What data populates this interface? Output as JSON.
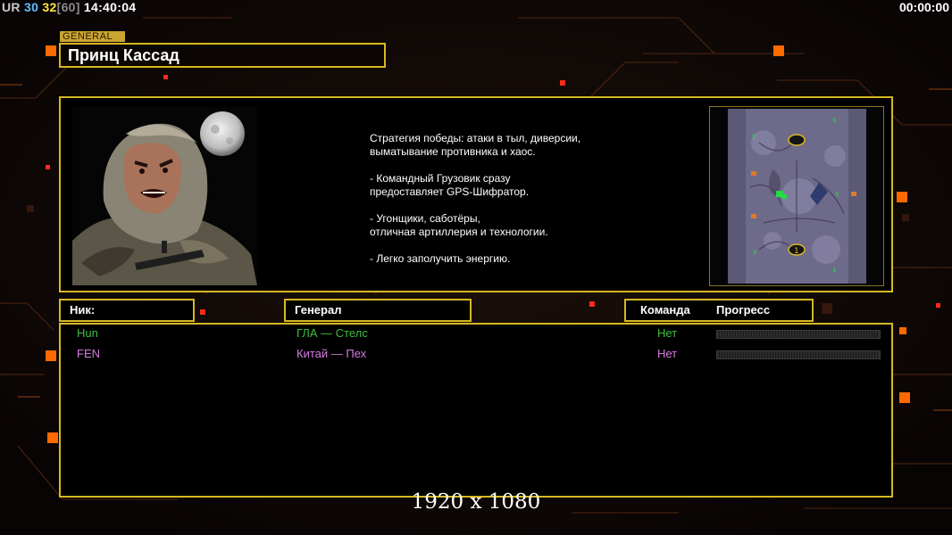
{
  "hud": {
    "ur": "UR",
    "fps_a": "30",
    "fps_b": "32",
    "fps_cap": "[60]",
    "clock": "14:40:04",
    "timer": "00:00:00"
  },
  "general": {
    "tag": "GENERAL",
    "name": "Принц Кассад",
    "description": "Стратегия победы: атаки в тыл, диверсии,\n выматывание противника и хаос.\n\n- Командный Грузовик сразу\nпредоставляет GPS-Шифратор.\n\n- Угонщики, саботёры,\nотличная артиллерия и технологии.\n\n- Легко заполучить энергию.",
    "portrait_icon": "gla-soldier-portrait",
    "map_icon": "minimap-preview"
  },
  "columns": {
    "nick": "Ник:",
    "general": "Генерал",
    "team": "Команда",
    "progress": "Прогресс"
  },
  "players": [
    {
      "nick": "Hun",
      "general": "ГЛА — Стелс",
      "team": "Нет",
      "progress": 0,
      "color": "#3fbf3f"
    },
    {
      "nick": "FEN",
      "general": "Китай — Пех",
      "team": "Нет",
      "progress": 0,
      "color": "#d77be0"
    }
  ],
  "resolution_label": "1920 x 1080",
  "colors": {
    "frame": "#d7b822",
    "accent_orange": "#ff6a00"
  }
}
